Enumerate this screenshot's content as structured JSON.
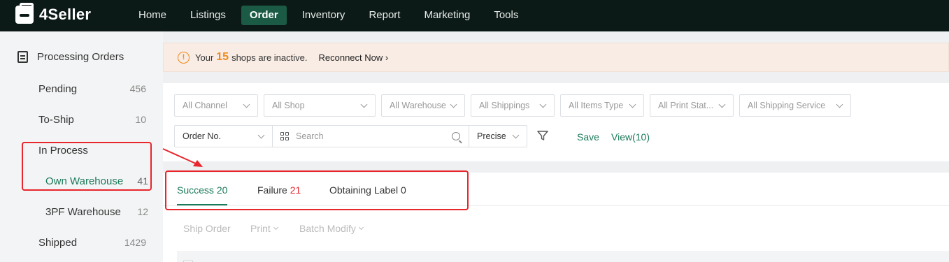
{
  "brand": {
    "name": "4Seller"
  },
  "topnav": {
    "items": [
      {
        "label": "Home",
        "active": false
      },
      {
        "label": "Listings",
        "active": false
      },
      {
        "label": "Order",
        "active": true
      },
      {
        "label": "Inventory",
        "active": false
      },
      {
        "label": "Report",
        "active": false
      },
      {
        "label": "Marketing",
        "active": false
      },
      {
        "label": "Tools",
        "active": false
      }
    ]
  },
  "sidebar": {
    "header": "Processing Orders",
    "pending": {
      "label": "Pending",
      "count": "456"
    },
    "to_ship": {
      "label": "To-Ship",
      "count": "10"
    },
    "in_process": "In Process",
    "own_warehouse": {
      "label": "Own Warehouse",
      "count": "41"
    },
    "tpf_warehouse": {
      "label": "3PF Warehouse",
      "count": "12"
    },
    "shipped": {
      "label": "Shipped",
      "count": "1429"
    }
  },
  "banner": {
    "prefix": "Your",
    "count": "15",
    "suffix": "shops are inactive.",
    "action": "Reconnect Now",
    "accent": "#f08a1c"
  },
  "filters": {
    "channel": "All Channel",
    "shop": "All Shop",
    "warehouse": "All Warehouse",
    "shippings": "All Shippings",
    "items_type": "All Items Type",
    "print_status": "All Print Stat...",
    "shipping_service": "All Shipping Service",
    "order_field": "Order No.",
    "search_placeholder": "Search",
    "match_mode": "Precise",
    "save": "Save",
    "view": "View(10)"
  },
  "tabs": {
    "success_label": "Success",
    "success_count": "20",
    "failure_label": "Failure",
    "failure_count": "21",
    "obtaining_label": "Obtaining Label 0"
  },
  "actions": {
    "ship_order": "Ship Order",
    "print": "Print",
    "batch_modify": "Batch Modify"
  },
  "colors": {
    "nav_bg": "#0c1a17",
    "brand_green": "#1b7a5a",
    "annotation_red": "#e8262b"
  }
}
